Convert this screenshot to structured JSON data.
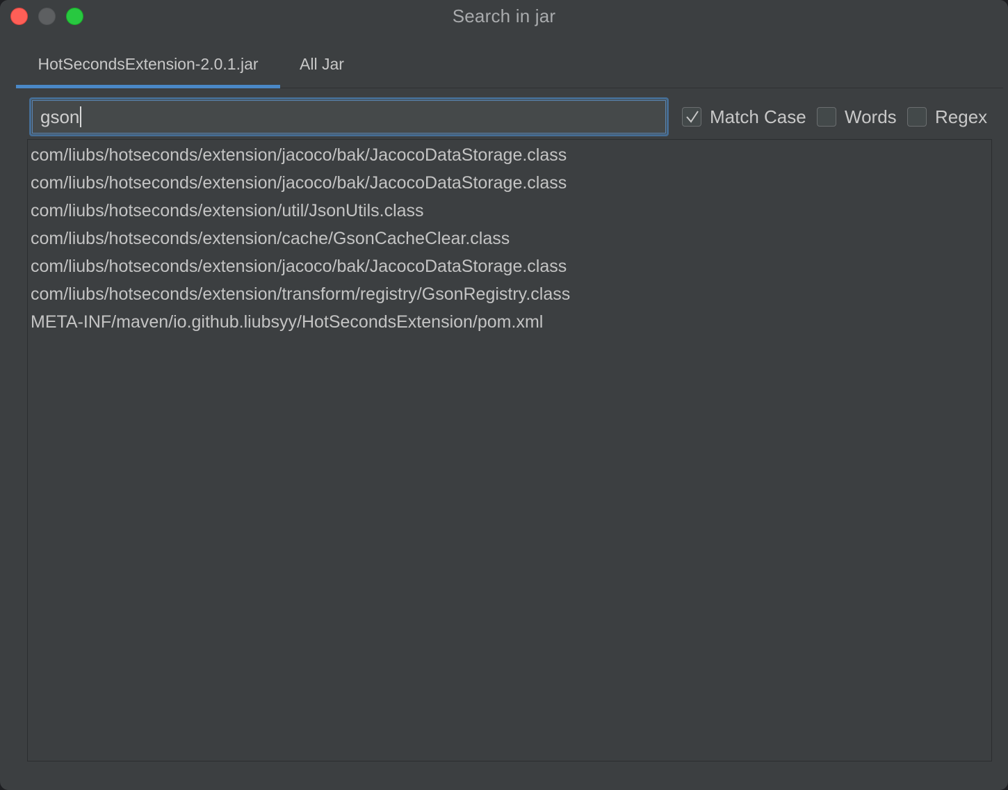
{
  "window": {
    "title": "Search in jar"
  },
  "tabs": [
    {
      "label": "HotSecondsExtension-2.0.1.jar",
      "active": true
    },
    {
      "label": "All Jar",
      "active": false
    }
  ],
  "search": {
    "value": "gson"
  },
  "options": {
    "match_case": {
      "label": "Match Case",
      "checked": true
    },
    "words": {
      "label": "Words",
      "checked": false
    },
    "regex": {
      "label": "Regex",
      "checked": false
    }
  },
  "results": [
    "com/liubs/hotseconds/extension/jacoco/bak/JacocoDataStorage.class",
    "com/liubs/hotseconds/extension/jacoco/bak/JacocoDataStorage.class",
    "com/liubs/hotseconds/extension/util/JsonUtils.class",
    "com/liubs/hotseconds/extension/cache/GsonCacheClear.class",
    "com/liubs/hotseconds/extension/jacoco/bak/JacocoDataStorage.class",
    "com/liubs/hotseconds/extension/transform/registry/GsonRegistry.class",
    "META-INF/maven/io.github.liubsyy/HotSecondsExtension/pom.xml"
  ],
  "colors": {
    "window_bg": "#3c3f41",
    "accent": "#4a88c7",
    "close": "#fe5f57",
    "maximize": "#28c840"
  }
}
